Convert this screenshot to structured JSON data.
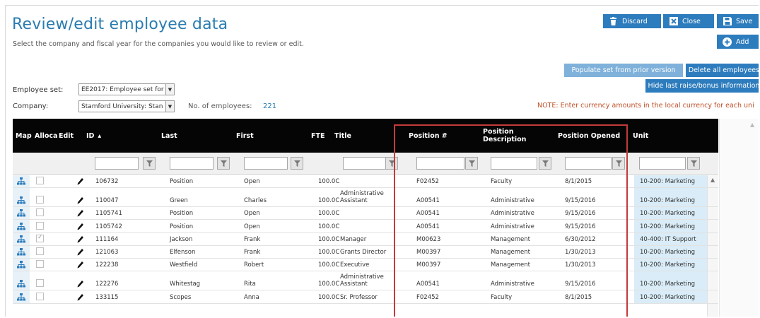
{
  "page": {
    "title": "Review/edit employee data",
    "subtitle": "Select the company and fiscal year for the companies you would like to review or edit."
  },
  "toolbar": {
    "discard_label": "Discard",
    "close_label": "Close",
    "save_label": "Save",
    "add_label": "Add",
    "populate_label": "Populate set from prior version",
    "delete_all_label": "Delete all employees",
    "hide_raise_label": "Hide last raise/bonus information"
  },
  "filters": {
    "employee_set_label": "Employee set:",
    "employee_set_value": "EE2017: Employee set for",
    "company_label": "Company:",
    "company_value": "Stamford University: Stan",
    "num_employees_label": "No. of employees:",
    "num_employees_value": "221"
  },
  "note": "NOTE: Enter currency amounts in the local currency for each uni",
  "colors": {
    "accent": "#2d7cbd",
    "title": "#2a7cb0",
    "note": "#c0502a",
    "highlight": "#c43a3a",
    "header_bg": "#050505"
  },
  "table": {
    "columns": {
      "map": "Map",
      "allocate": "Alloca",
      "edit": "Edit",
      "id": "ID",
      "last": "Last",
      "first": "First",
      "fte": "FTE",
      "title": "Title",
      "position_num": "Position #",
      "position_desc": "Position Description",
      "position_opened": "Position Opened",
      "unit": "Unit"
    },
    "sort_indicator": "▴",
    "rows": [
      {
        "id": "106732",
        "last": "Position",
        "first": "Open",
        "fte": "100.0C",
        "title": "",
        "position_num": "F02452",
        "position_desc": "Faculty",
        "position_opened": "8/1/2015",
        "unit": "10-200: Marketing",
        "allocated": false
      },
      {
        "id": "110047",
        "last": "Green",
        "first": "Charles",
        "fte": "100.0C",
        "title": "Administrative Assistant",
        "position_num": "A00541",
        "position_desc": "Administrative",
        "position_opened": "9/15/2016",
        "unit": "10-200: Marketing",
        "allocated": false
      },
      {
        "id": "1105741",
        "last": "Position",
        "first": "Open",
        "fte": "100.0C",
        "title": "",
        "position_num": "A00541",
        "position_desc": "Administrative",
        "position_opened": "9/15/2016",
        "unit": "10-200: Marketing",
        "allocated": false
      },
      {
        "id": "1105742",
        "last": "Position",
        "first": "Open",
        "fte": "100.0C",
        "title": "",
        "position_num": "A00541",
        "position_desc": "Administrative",
        "position_opened": "9/15/2016",
        "unit": "10-200: Marketing",
        "allocated": false
      },
      {
        "id": "111164",
        "last": "Jackson",
        "first": "Frank",
        "fte": "100.0C",
        "title": "Manager",
        "position_num": "M00623",
        "position_desc": "Management",
        "position_opened": "6/30/2012",
        "unit": "40-400: IT Support",
        "allocated": true
      },
      {
        "id": "121063",
        "last": "Elfenson",
        "first": "Frank",
        "fte": "100.0C",
        "title": "Grants Director",
        "position_num": "M00397",
        "position_desc": "Management",
        "position_opened": "1/30/2013",
        "unit": "10-200: Marketing",
        "allocated": false
      },
      {
        "id": "122238",
        "last": "Westfield",
        "first": "Robert",
        "fte": "100.0C",
        "title": "Executive",
        "position_num": "M00397",
        "position_desc": "Management",
        "position_opened": "1/30/2013",
        "unit": "10-200: Marketing",
        "allocated": false
      },
      {
        "id": "122276",
        "last": "Whitestag",
        "first": "Rita",
        "fte": "100.0C",
        "title": "Administrative Assistant",
        "position_num": "A00541",
        "position_desc": "Administrative",
        "position_opened": "9/15/2016",
        "unit": "10-200: Marketing",
        "allocated": false
      },
      {
        "id": "133115",
        "last": "Scopes",
        "first": "Anna",
        "fte": "100.0C",
        "title": "Sr. Professor",
        "position_num": "F02452",
        "position_desc": "Faculty",
        "position_opened": "8/1/2015",
        "unit": "10-200: Marketing",
        "allocated": false
      }
    ]
  }
}
